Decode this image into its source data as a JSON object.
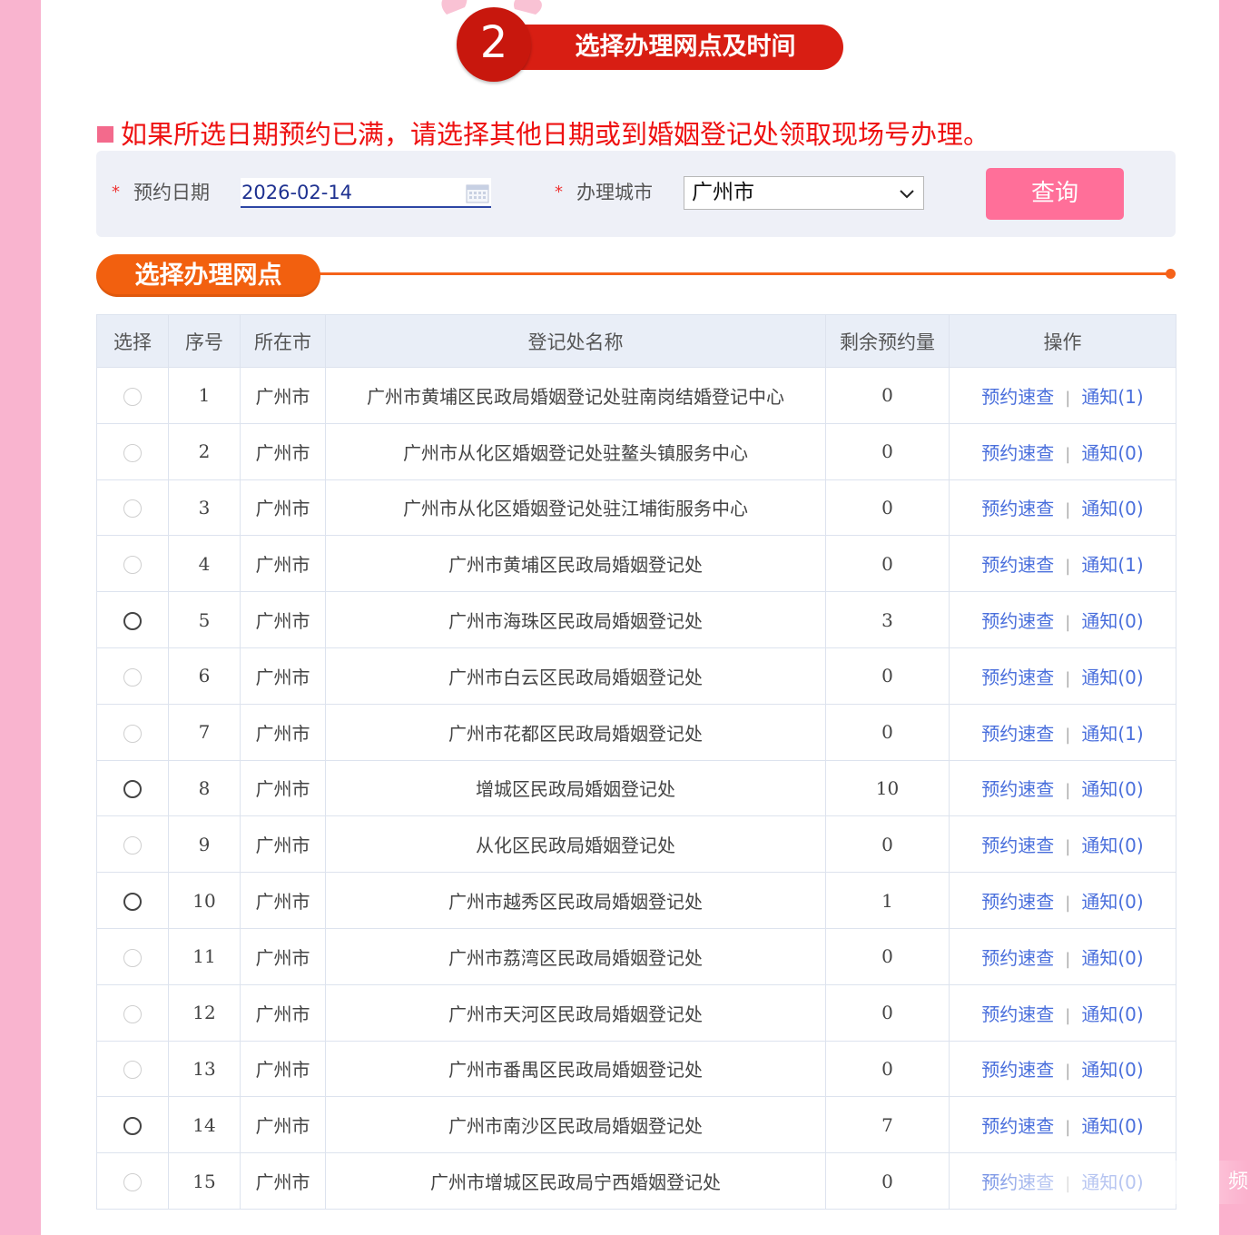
{
  "step": {
    "number": "2",
    "title": "选择办理网点及时间"
  },
  "notice": "如果所选日期预约已满，请选择其他日期或到婚姻登记处领取现场号办理。",
  "form": {
    "date_label": "预约日期",
    "date_value": "2026-02-14",
    "city_label": "办理城市",
    "city_value": "广州市",
    "query_label": "查询",
    "required_mark": "*"
  },
  "section_title": "选择办理网点",
  "table": {
    "headers": [
      "选择",
      "序号",
      "所在市",
      "登记处名称",
      "剩余预约量",
      "操作"
    ],
    "rows": [
      {
        "selectable": false,
        "no": "1",
        "city": "广州市",
        "name": "广州市黄埔区民政局婚姻登记处驻南岗结婚登记中心",
        "remaining": "0",
        "query": "预约速查",
        "notify": "通知(1)"
      },
      {
        "selectable": false,
        "no": "2",
        "city": "广州市",
        "name": "广州市从化区婚姻登记处驻鳌头镇服务中心",
        "remaining": "0",
        "query": "预约速查",
        "notify": "通知(0)"
      },
      {
        "selectable": false,
        "no": "3",
        "city": "广州市",
        "name": "广州市从化区婚姻登记处驻江埔街服务中心",
        "remaining": "0",
        "query": "预约速查",
        "notify": "通知(0)"
      },
      {
        "selectable": false,
        "no": "4",
        "city": "广州市",
        "name": "广州市黄埔区民政局婚姻登记处",
        "remaining": "0",
        "query": "预约速查",
        "notify": "通知(1)"
      },
      {
        "selectable": true,
        "no": "5",
        "city": "广州市",
        "name": "广州市海珠区民政局婚姻登记处",
        "remaining": "3",
        "query": "预约速查",
        "notify": "通知(0)"
      },
      {
        "selectable": false,
        "no": "6",
        "city": "广州市",
        "name": "广州市白云区民政局婚姻登记处",
        "remaining": "0",
        "query": "预约速查",
        "notify": "通知(0)"
      },
      {
        "selectable": false,
        "no": "7",
        "city": "广州市",
        "name": "广州市花都区民政局婚姻登记处",
        "remaining": "0",
        "query": "预约速查",
        "notify": "通知(1)"
      },
      {
        "selectable": true,
        "no": "8",
        "city": "广州市",
        "name": "增城区民政局婚姻登记处",
        "remaining": "10",
        "query": "预约速查",
        "notify": "通知(0)"
      },
      {
        "selectable": false,
        "no": "9",
        "city": "广州市",
        "name": "从化区民政局婚姻登记处",
        "remaining": "0",
        "query": "预约速查",
        "notify": "通知(0)"
      },
      {
        "selectable": true,
        "no": "10",
        "city": "广州市",
        "name": "广州市越秀区民政局婚姻登记处",
        "remaining": "1",
        "query": "预约速查",
        "notify": "通知(0)"
      },
      {
        "selectable": false,
        "no": "11",
        "city": "广州市",
        "name": "广州市荔湾区民政局婚姻登记处",
        "remaining": "0",
        "query": "预约速查",
        "notify": "通知(0)"
      },
      {
        "selectable": false,
        "no": "12",
        "city": "广州市",
        "name": "广州市天河区民政局婚姻登记处",
        "remaining": "0",
        "query": "预约速查",
        "notify": "通知(0)"
      },
      {
        "selectable": false,
        "no": "13",
        "city": "广州市",
        "name": "广州市番禺区民政局婚姻登记处",
        "remaining": "0",
        "query": "预约速查",
        "notify": "通知(0)"
      },
      {
        "selectable": true,
        "no": "14",
        "city": "广州市",
        "name": "广州市南沙区民政局婚姻登记处",
        "remaining": "7",
        "query": "预约速查",
        "notify": "通知(0)"
      },
      {
        "selectable": false,
        "no": "15",
        "city": "广州市",
        "name": "广州市增城区民政局宁西婚姻登记处",
        "remaining": "0",
        "query": "预约速查",
        "notify": "通知(0)"
      }
    ]
  },
  "watermark": "频",
  "colors": {
    "accent_red": "#d81e13",
    "accent_orange": "#f2600f",
    "button_pink": "#ff6f99",
    "link_blue": "#4a6fdc",
    "page_bg_pink": "#f9b4cf"
  }
}
